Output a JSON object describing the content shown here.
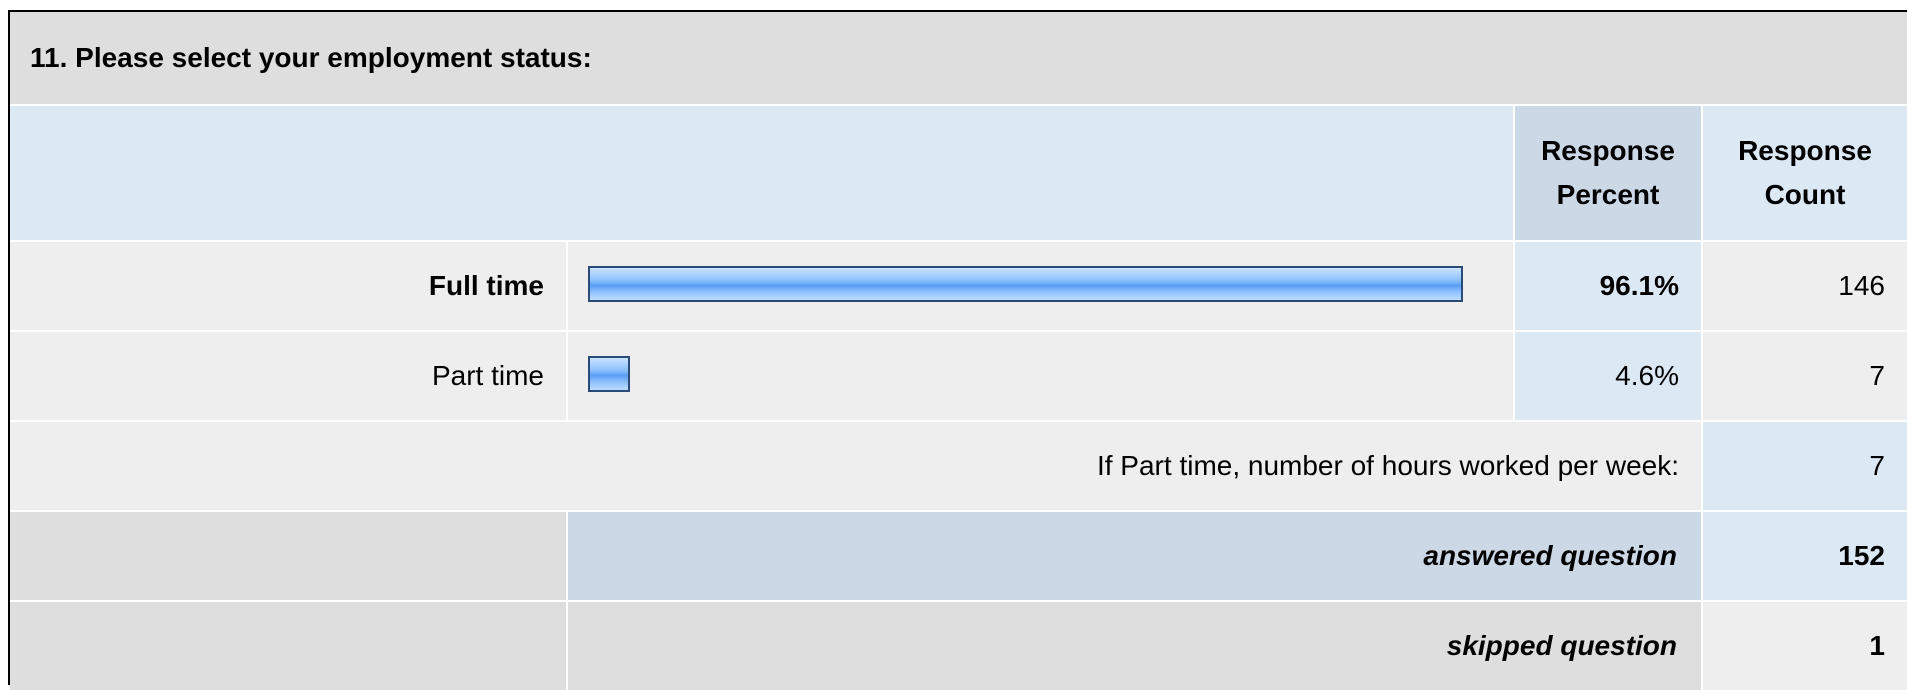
{
  "question": {
    "title": "11. Please select your employment status:"
  },
  "headers": {
    "response_percent": "Response Percent",
    "response_count": "Response Count"
  },
  "open_ended": {
    "label": "If Part time, number of hours worked per week:",
    "count": "7"
  },
  "summary": {
    "answered_label": "answered question",
    "answered_count": "152",
    "skipped_label": "skipped question",
    "skipped_count": "1"
  },
  "colors": {
    "bar_fill": "#8ec1ff",
    "bar_border": "#2a4a7a",
    "header_blue": "#dde8f5",
    "header_blue_dark": "#ccd8e6",
    "row_gray": "#eeeeee"
  },
  "chart_data": {
    "type": "bar",
    "orientation": "horizontal",
    "categories": [
      "Full time",
      "Part time"
    ],
    "series": [
      {
        "values": [
          96.1,
          4.6
        ]
      }
    ],
    "percent_labels": [
      "96.1%",
      "4.6%"
    ],
    "counts": [
      "146",
      "7"
    ],
    "xlim": [
      0,
      100
    ],
    "emphasized_category": "Full time",
    "grid": false
  }
}
